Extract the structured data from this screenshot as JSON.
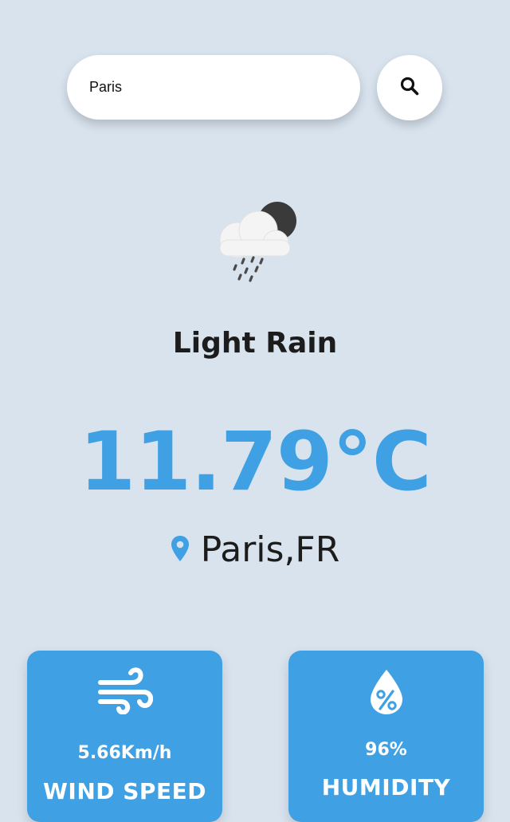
{
  "search": {
    "value": "Paris",
    "icon": "search-icon"
  },
  "weather": {
    "icon": "cloud-moon-rain-icon",
    "condition": "Light Rain",
    "temperature": "11.79°C",
    "location": "Paris,FR",
    "location_icon": "location-pin-icon"
  },
  "stats": {
    "wind": {
      "value": "5.66Km/h",
      "label": "WIND SPEED",
      "icon": "wind-icon"
    },
    "humidity": {
      "value": "96%",
      "label": "HUMIDITY",
      "icon": "humidity-drop-icon"
    }
  },
  "colors": {
    "background": "#d8e3ee",
    "accent": "#3fa1e4",
    "text_dark": "#1c1c1c"
  }
}
